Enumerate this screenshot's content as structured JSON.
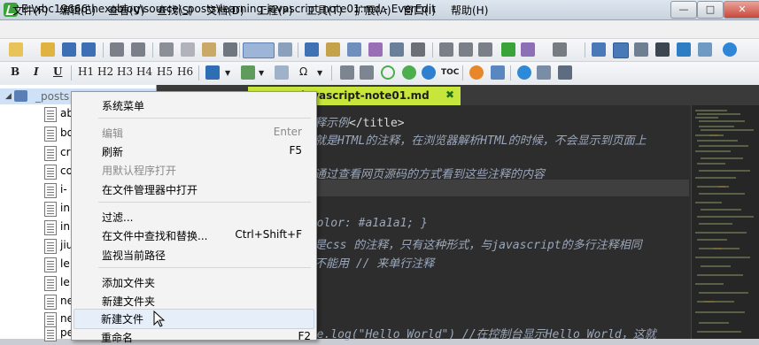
{
  "window": {
    "title": "E:\\xbc19666\\hexoblog\\source\\_posts\\learning-javascript-note01.md - EverEdit"
  },
  "window_controls": {
    "minimize": "—",
    "maximize": "□",
    "close": "✕"
  },
  "menubar": {
    "items": [
      "文件(F)",
      "编辑(E)",
      "查看(V)",
      "查找(S)",
      "文档(D)",
      "工程(P)",
      "工具(T)",
      "扩展(A)",
      "窗口(I)",
      "帮助(H)"
    ]
  },
  "format_toolbar": {
    "bold": "B",
    "italic": "I",
    "underline": "U",
    "headings": [
      "H1",
      "H2",
      "H3",
      "H4",
      "H5",
      "H6"
    ],
    "toc": "TOC",
    "omega": "Ω"
  },
  "sidebar": {
    "root_label": "_posts",
    "files": [
      "ab",
      "bo",
      "cr",
      "co",
      "i-",
      "in",
      "in",
      "jiu",
      "le",
      "le",
      "ne",
      "ne",
      "pe"
    ]
  },
  "editor": {
    "tab_label": "-javascript-note01.md",
    "tab_close": "✖",
    "lines": [
      {
        "text": "注释示例</title>",
        "style": "code"
      },
      {
        "text": "是就是HTML的注释，在浏览器解析HTML的时候，不会显示到页面上",
        "style": "comment"
      },
      {
        "text": "以通过查看网页源码的方式看到这些注释的内容",
        "style": "comment"
      },
      {
        "text": " {color: #a1a1a1; }",
        "style": "comment"
      },
      {
        "text": "这是css 的注释，只有这种形式，与javascript的多行注释相同",
        "style": "comment"
      },
      {
        "text": "是不能用 // 来单行注释",
        "style": "comment"
      },
      {
        "text": "ole.log(\"Hello World\") //在控制台显示Hello World，这就",
        "style": "comment"
      }
    ]
  },
  "context_menu": {
    "items": [
      {
        "label": "系统菜单",
        "shortcut": "",
        "disabled": false
      },
      {
        "label": "编辑",
        "shortcut": "Enter",
        "disabled": true
      },
      {
        "label": "刷新",
        "shortcut": "F5",
        "disabled": false
      },
      {
        "label": "用默认程序打开",
        "shortcut": "",
        "disabled": true
      },
      {
        "label": "在文件管理器中打开",
        "shortcut": "",
        "disabled": false
      },
      {
        "label": "过滤...",
        "shortcut": "",
        "disabled": false
      },
      {
        "label": "在文件中查找和替换...",
        "shortcut": "Ctrl+Shift+F",
        "disabled": false
      },
      {
        "label": "监视当前路径",
        "shortcut": "",
        "disabled": false
      },
      {
        "label": "添加文件夹",
        "shortcut": "",
        "disabled": false
      },
      {
        "label": "新建文件夹",
        "shortcut": "",
        "disabled": false
      },
      {
        "label": "新建文件",
        "shortcut": "",
        "disabled": false
      },
      {
        "label": "重命名",
        "shortcut": "F2",
        "disabled": false
      }
    ]
  },
  "colors": {
    "tab_active": "#c7e63b",
    "editor_bg": "#2d2d2d",
    "comment": "#9aa7bc"
  }
}
